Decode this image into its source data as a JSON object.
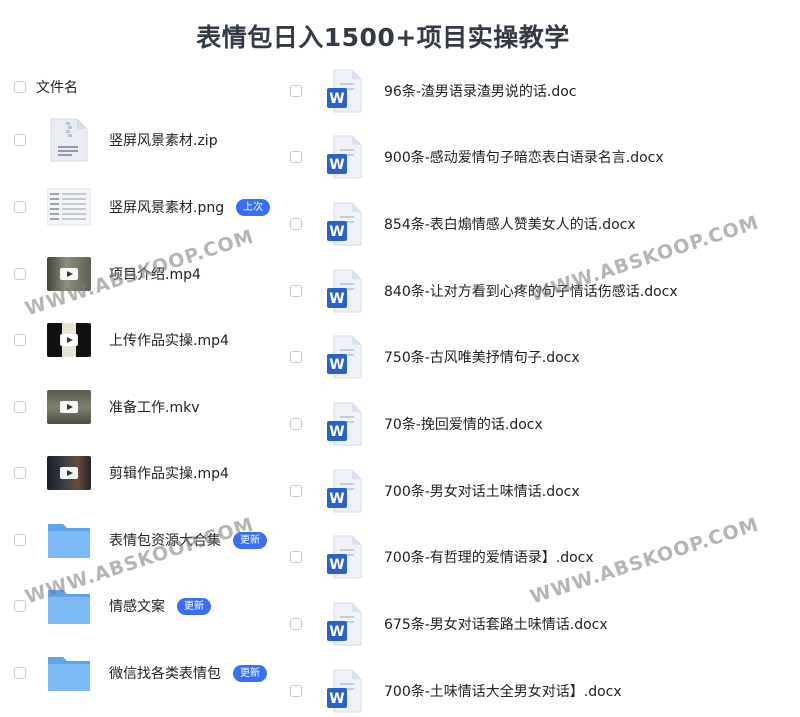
{
  "title": "表情包日入1500+项目实操教学",
  "header": {
    "column_label": "文件名"
  },
  "left_files": [
    {
      "name": "竖屏风景素材.zip",
      "icon": "zip-file-icon",
      "badge": ""
    },
    {
      "name": "竖屏风景素材.png",
      "icon": "image-thumbnail",
      "badge": "上次"
    },
    {
      "name": "项目介绍.mp4",
      "icon": "video-thumbnail",
      "badge": ""
    },
    {
      "name": "上传作品实操.mp4",
      "icon": "video-thumbnail",
      "badge": ""
    },
    {
      "name": "准备工作.mkv",
      "icon": "video-thumbnail",
      "badge": ""
    },
    {
      "name": "剪辑作品实操.mp4",
      "icon": "video-thumbnail",
      "badge": ""
    },
    {
      "name": "表情包资源大合集",
      "icon": "folder-icon",
      "badge": "更新"
    },
    {
      "name": "情感文案",
      "icon": "folder-icon",
      "badge": "更新"
    },
    {
      "name": "微信找各类表情包",
      "icon": "folder-icon",
      "badge": "更新"
    }
  ],
  "right_files": [
    {
      "name": "96条-渣男语录渣男说的话.doc",
      "icon": "word-doc-icon"
    },
    {
      "name": "900条-感动爱情句子暗恋表白语录名言.docx",
      "icon": "word-doc-icon"
    },
    {
      "name": "854条-表白煽情感人赞美女人的话.docx",
      "icon": "word-doc-icon"
    },
    {
      "name": "840条-让对方看到心疼的句子情话伤感话.docx",
      "icon": "word-doc-icon"
    },
    {
      "name": "750条-古风唯美抒情句子.docx",
      "icon": "word-doc-icon"
    },
    {
      "name": "70条-挽回爱情的话.docx",
      "icon": "word-doc-icon"
    },
    {
      "name": "700条-男女对话土味情话.docx",
      "icon": "word-doc-icon"
    },
    {
      "name": "700条-有哲理的爱情语录】.docx",
      "icon": "word-doc-icon"
    },
    {
      "name": "675条-男女对话套路土味情话.docx",
      "icon": "word-doc-icon"
    },
    {
      "name": "700条-土味情话大全男女对话】.docx",
      "icon": "word-doc-icon"
    }
  ],
  "watermark": "WWW.ABSKOOP.COM",
  "colors": {
    "badge": "#3b6ff3",
    "folder": "#6fb0f5",
    "word": "#2b62c8"
  }
}
